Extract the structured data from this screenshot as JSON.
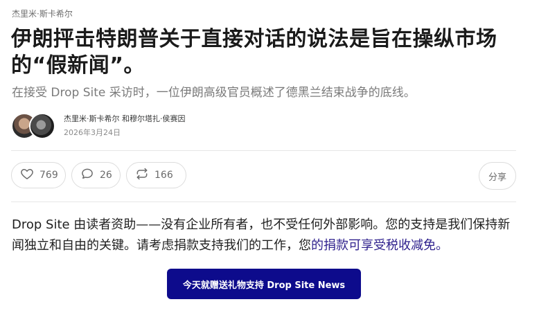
{
  "post": {
    "section_label": "杰里米·斯卡希尔",
    "title": "伊朗抨击特朗普关于直接对话的说法是旨在操纵市场的“假新闻”。",
    "subtitle": "在接受 Drop Site 采访时，一位伊朗高级官员概述了德黑兰结束战争的底线。",
    "authors": "杰里米·斯卡希尔 和穆尔塔扎·侯赛因",
    "date": "2026年3月24日"
  },
  "actions": {
    "like_count": "769",
    "comment_count": "26",
    "restack_count": "166",
    "share_label": "分享"
  },
  "support": {
    "text_main": "Drop Site 由读者资助——没有企业所有者，也不受任何外部影响。您的支持是我们保持新闻独立和自由的关键。请考虑捐款支持我们的工作，您",
    "text_link": "的捐款可享受税收减免。",
    "button_label": "今天就赠送礼物支持 Drop Site News",
    "button_color": "#0d0b8c",
    "link_color": "#2d1f8c"
  },
  "icons": {
    "like": "heart-icon",
    "comment": "comment-bubble-icon",
    "restack": "restack-arrows-icon",
    "avatar_1": "author-avatar-photo",
    "avatar_2": "author-avatar-photo"
  }
}
